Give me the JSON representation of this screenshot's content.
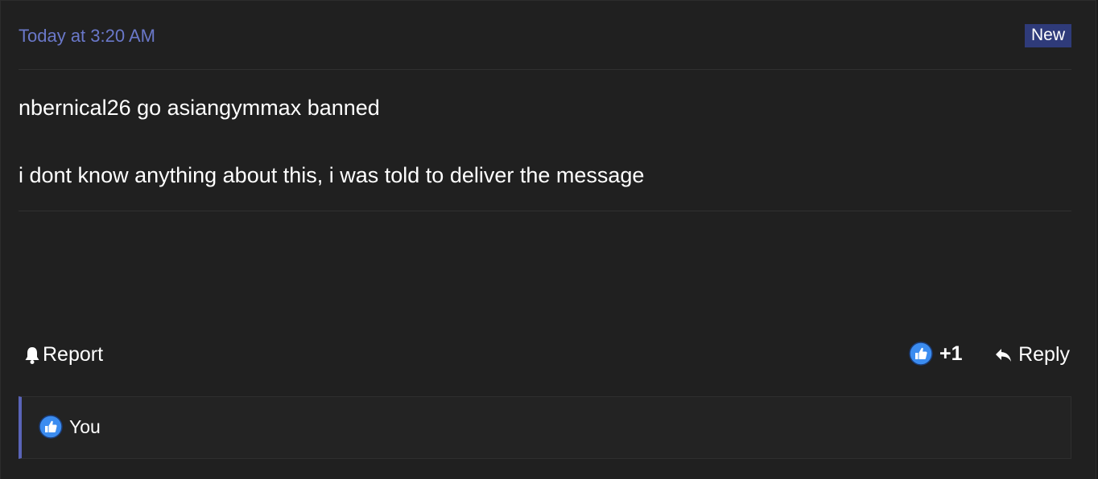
{
  "post": {
    "date": "Today at 3:20 AM",
    "badge": "New",
    "lines": [
      "nbernical26 go asiangymmax banned",
      "i dont know anything about this, i was told to deliver the message"
    ]
  },
  "actions": {
    "report_label": "Report",
    "like_count": "+1",
    "reply_label": "Reply"
  },
  "reactions": {
    "users": "You"
  },
  "colors": {
    "accent": "#6a78c9",
    "badge_bg": "#2f3b7a",
    "like_blue": "#3b8cf0",
    "reaction_border": "#5a64b8"
  },
  "icons": {
    "report": "bell-icon",
    "like": "thumbs-up-icon",
    "reply": "reply-arrow-icon"
  }
}
